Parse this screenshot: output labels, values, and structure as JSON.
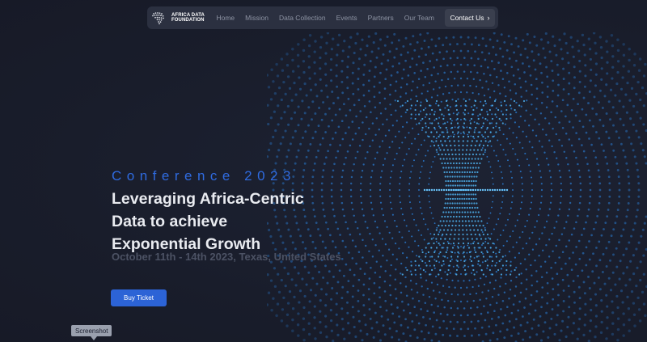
{
  "navbar": {
    "brand_line1": "AFRICA DATA",
    "brand_line2": "FOUNDATION",
    "brand_logo_icon": "africa-map-logo-icon",
    "links": [
      {
        "label": "Home"
      },
      {
        "label": "Mission"
      },
      {
        "label": "Data Collection"
      },
      {
        "label": "Events"
      },
      {
        "label": "Partners"
      },
      {
        "label": "Our Team"
      }
    ],
    "contact_label": "Contact Us",
    "contact_icon": "chevron-right-icon"
  },
  "hero": {
    "kicker": "Conference 2023",
    "title_line1": "Leveraging Africa-Centric",
    "title_line2": "Data to achieve",
    "title_line3": "Exponential Growth",
    "date": "October 11th - 14th 2023, Texas, United States",
    "buy_label": "Buy Ticket"
  },
  "tooltip": {
    "label": "Screenshot"
  },
  "colors": {
    "background": "#1a1e2e",
    "accent": "#2f6be0",
    "button": "#2c63d6",
    "dots": "#2a8fe0"
  }
}
